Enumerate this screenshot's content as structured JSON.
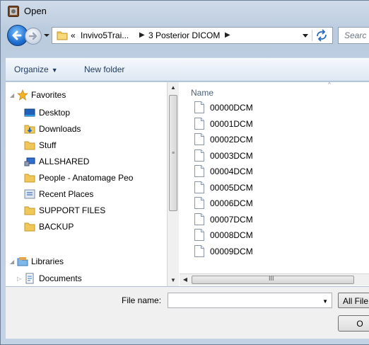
{
  "window": {
    "title": "Open"
  },
  "nav": {
    "back_icon": "back-arrow-icon",
    "forward_icon": "forward-arrow-icon",
    "address": {
      "prefix": "«",
      "segments": [
        "Invivo5Trai...",
        "3 Posterior DICOM"
      ]
    },
    "search_placeholder": "Searc"
  },
  "toolbar": {
    "organize": "Organize",
    "new_folder": "New folder"
  },
  "sidebar": {
    "favorites_label": "Favorites",
    "favorites": [
      {
        "label": "Desktop",
        "icon": "desktop-icon"
      },
      {
        "label": "Downloads",
        "icon": "downloads-folder-icon"
      },
      {
        "label": "Stuff",
        "icon": "folder-icon"
      },
      {
        "label": "ALLSHARED",
        "icon": "network-drive-icon"
      },
      {
        "label": "People - Anatomage Peo",
        "icon": "folder-icon"
      },
      {
        "label": "Recent Places",
        "icon": "recent-places-icon"
      },
      {
        "label": "SUPPORT FILES",
        "icon": "folder-icon"
      },
      {
        "label": "BACKUP",
        "icon": "folder-icon"
      }
    ],
    "libraries_label": "Libraries",
    "libraries": [
      {
        "label": "Documents",
        "icon": "documents-icon"
      }
    ]
  },
  "files": {
    "column_header": "Name",
    "items": [
      "00000DCM",
      "00001DCM",
      "00002DCM",
      "00003DCM",
      "00004DCM",
      "00005DCM",
      "00006DCM",
      "00007DCM",
      "00008DCM",
      "00009DCM"
    ],
    "scroll_grip": "III"
  },
  "bottom": {
    "file_name_label": "File name:",
    "file_name_value": "",
    "filter_label": "All File",
    "open_button": "O"
  },
  "colors": {
    "frame": "#bcccdf",
    "toolbar_text": "#1e395b",
    "header_text": "#4c607a"
  }
}
